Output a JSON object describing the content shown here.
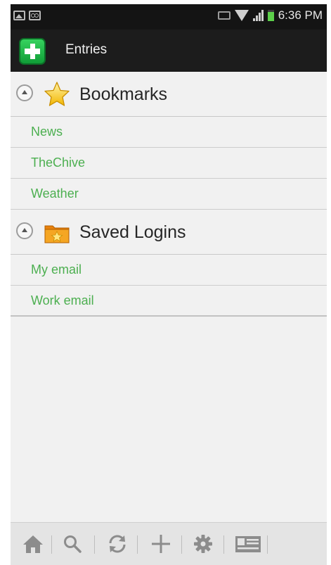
{
  "status_bar": {
    "time": "6:36 PM",
    "left_icons": [
      "picture-icon",
      "voicemail-icon"
    ],
    "right_icons": [
      "mute-icon",
      "wifi-icon",
      "signal-icon",
      "battery-icon"
    ],
    "battery_color": "#5ccf4a"
  },
  "action_bar": {
    "title": "Entries",
    "app_icon": "add-plus-icon",
    "app_icon_color": "#1fb548"
  },
  "groups": [
    {
      "title": "Bookmarks",
      "icon": "star-icon",
      "entries": [
        "News",
        "TheChive",
        "Weather"
      ]
    },
    {
      "title": "Saved Logins",
      "icon": "folder-icon",
      "entries": [
        "My email",
        "Work email"
      ]
    }
  ],
  "theme": {
    "entry_text_color": "#4caf50",
    "background": "#f1f1f1"
  },
  "toolbar": {
    "buttons": [
      "home-icon",
      "search-icon",
      "refresh-icon",
      "add-icon",
      "settings-icon",
      "card-icon"
    ]
  }
}
